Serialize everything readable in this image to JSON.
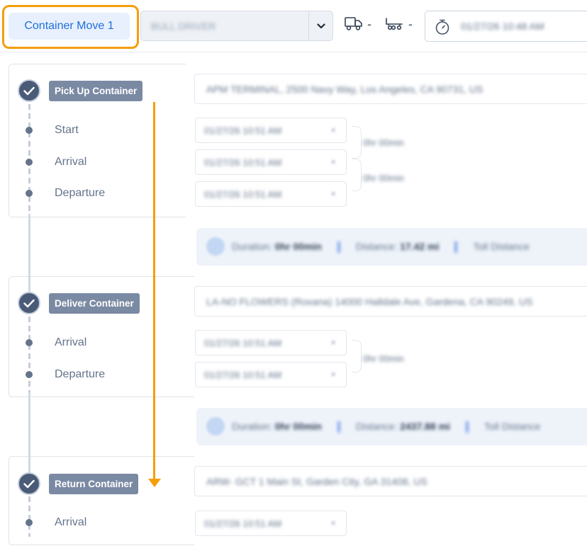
{
  "header": {
    "move_tab_label": "Container Move 1",
    "driver_select_value": "BULL DRIVER",
    "datetime_value": "01/27/26 10:48 AM"
  },
  "steps": [
    {
      "label": "Pick Up Container",
      "address": "APM TERMINAL, 2500 Navy Way, Los Angeles, CA 90731, US",
      "events": [
        {
          "label": "Start",
          "value": "01/27/26 10:51 AM",
          "clear": "×"
        },
        {
          "label": "Arrival",
          "value": "01/27/26 10:51 AM",
          "clear": "×"
        },
        {
          "label": "Departure",
          "value": "01/27/26 10:51 AM",
          "clear": "×"
        }
      ],
      "gaps": [
        "0hr 00min",
        "0hr 00min"
      ]
    },
    {
      "label": "Deliver Container",
      "address": "LA-NO FLOWERS (Roxana) 14000 Halldale Ave, Gardena, CA 90249, US",
      "events": [
        {
          "label": "Arrival",
          "value": "01/27/26 10:51 AM",
          "clear": "×"
        },
        {
          "label": "Departure",
          "value": "01/27/26 10:51 AM",
          "clear": "×"
        }
      ],
      "gaps": [
        "0hr 00min"
      ]
    },
    {
      "label": "Return Container",
      "address": "ARW- GCT 1 Main St, Garden City, GA 31408, US",
      "events": [
        {
          "label": "Arrival",
          "value": "01/27/26 10:51 AM",
          "clear": "×"
        }
      ]
    }
  ],
  "legs": [
    {
      "duration_label": "Duration:",
      "duration_value": "0hr 00min",
      "distance_label": "Distance:",
      "distance_value": "17.42 mi",
      "toll_label": "Toll Distance"
    },
    {
      "duration_label": "Duration:",
      "duration_value": "0hr 00min",
      "distance_label": "Distance:",
      "distance_value": "2437.88 mi",
      "toll_label": "Toll Distance"
    }
  ],
  "colors": {
    "highlight": "#f59e0b",
    "accent_blue": "#1e6fd9",
    "step_label_bg": "#7b8aa3",
    "check_bg": "#4a5b78"
  }
}
